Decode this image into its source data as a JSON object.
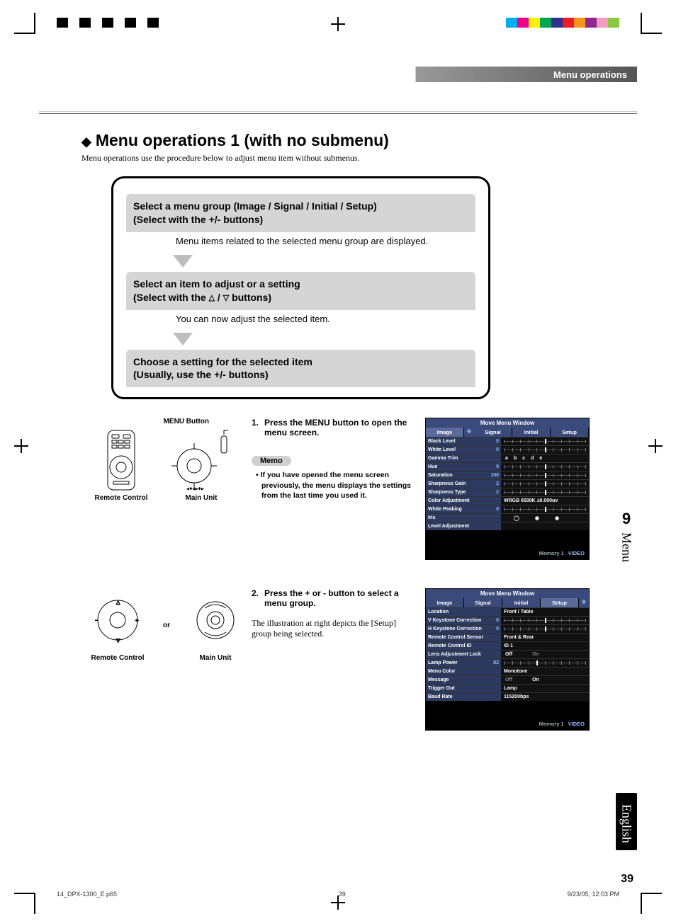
{
  "header": {
    "section": "Menu operations"
  },
  "title": "Menu operations 1 (with no submenu)",
  "intro": "Menu operations use the procedure below to adjust menu item without submenus.",
  "flow": {
    "step1": {
      "heading": "Select a menu group (Image / Signal / Initial / Setup)\n(Select with the +/- buttons)",
      "note": "Menu items related to the selected menu group are displayed."
    },
    "step2": {
      "heading_a": "Select an item to adjust or a setting",
      "heading_b_pre": "(Select with the ",
      "heading_b_post": " buttons)",
      "note": "You can now adjust the selected item."
    },
    "step3": {
      "heading": "Choose a setting for the selected item\n(Usually, use the +/- buttons)"
    }
  },
  "devices": {
    "menu_button_label": "MENU Button",
    "remote_label": "Remote Control",
    "main_unit_label": "Main Unit",
    "or": "or"
  },
  "steps": {
    "s1_num": "1.",
    "s1_text": "Press the MENU button to open the menu screen.",
    "memo_label": "Memo",
    "memo_text": "If you have opened the menu screen previously, the menu displays the settings from the last time you used it.",
    "s2_num": "2.",
    "s2_text": "Press the + or - button to select a menu group.",
    "s2_note": "The illustration at right depicts the [Setup] group being selected."
  },
  "menu1": {
    "title": "Move Menu Window",
    "tabs": [
      "Image",
      "Signal",
      "Initial",
      "Setup"
    ],
    "selected_tab": 0,
    "rows": [
      {
        "name": "Black Level",
        "val": "0",
        "type": "slider",
        "pos": 50
      },
      {
        "name": "White Level",
        "val": "0",
        "type": "slider",
        "pos": 50
      },
      {
        "name": "Gamma Trim",
        "val": "",
        "type": "opts",
        "opts": [
          "a",
          "b",
          "c",
          "d",
          "e"
        ]
      },
      {
        "name": "Hue",
        "val": "0",
        "type": "slider",
        "pos": 50
      },
      {
        "name": "Saturation",
        "val": "100",
        "type": "slider",
        "pos": 50
      },
      {
        "name": "Sharpness Gain",
        "val": "2",
        "type": "slider",
        "pos": 50
      },
      {
        "name": "Sharpness Type",
        "val": "2",
        "type": "slider",
        "pos": 50
      },
      {
        "name": "Color Adjustment",
        "val": "",
        "type": "text",
        "text": "WRGB          6500K ±0.000uv"
      },
      {
        "name": "White Peaking",
        "val": "0",
        "type": "slider",
        "pos": 50
      },
      {
        "name": "Iris",
        "val": "",
        "type": "radio"
      },
      {
        "name": "Level Adjustment",
        "val": "",
        "type": "blank"
      }
    ],
    "footer_mem": "Memory 1",
    "footer_src": "VIDEO"
  },
  "menu2": {
    "title": "Move Menu Window",
    "tabs": [
      "Image",
      "Signal",
      "Initial",
      "Setup"
    ],
    "selected_tab": 3,
    "rows": [
      {
        "name": "Location",
        "val": "",
        "type": "text",
        "text": "Front / Table"
      },
      {
        "name": "V Keystone Correction",
        "val": "0",
        "type": "slider",
        "pos": 50
      },
      {
        "name": "H Keystone Correction",
        "val": "0",
        "type": "slider",
        "pos": 50
      },
      {
        "name": "Remote Control Sensor",
        "val": "",
        "type": "text",
        "text": "Front & Rear"
      },
      {
        "name": "Remote Control ID",
        "val": "",
        "type": "text",
        "text": "ID 1"
      },
      {
        "name": "Lens Adjustment Lock",
        "val": "",
        "type": "toggle",
        "opts": [
          "Off",
          "On"
        ],
        "sel": 0
      },
      {
        "name": "Lamp Power",
        "val": "82",
        "type": "slider",
        "pos": 40
      },
      {
        "name": "Menu Color",
        "val": "",
        "type": "text",
        "text": "Monotone"
      },
      {
        "name": "Message",
        "val": "",
        "type": "toggle",
        "opts": [
          "Off",
          "On"
        ],
        "sel": 1
      },
      {
        "name": "Trigger Out",
        "val": "",
        "type": "text",
        "text": "Lamp"
      },
      {
        "name": "Baud Rate",
        "val": "",
        "type": "text",
        "text": "115200bps"
      }
    ],
    "footer_mem": "Memory 1",
    "footer_src": "VIDEO"
  },
  "sidebar": {
    "chapter_num": "9",
    "chapter_word": "Menu",
    "language": "English"
  },
  "page_number": "39",
  "footer": {
    "file": "14_DPX-1300_E.p65",
    "page": "39",
    "date": "9/23/05, 12:03 PM"
  },
  "print_colors_left": [
    "#000",
    "#fff",
    "#000",
    "#fff",
    "#000",
    "#fff",
    "#000",
    "#fff",
    "#000",
    "#fff"
  ],
  "print_colors_right": [
    "#00aeef",
    "#ec008c",
    "#fff200",
    "#00a651",
    "#2e3192",
    "#ed1c24",
    "#f7941d",
    "#92278f",
    "#f49ac1",
    "#8dc63f"
  ]
}
